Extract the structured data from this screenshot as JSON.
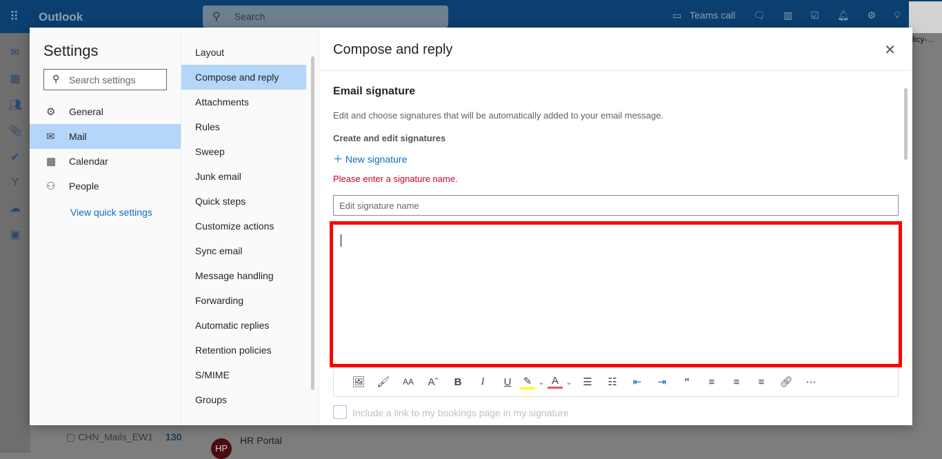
{
  "topbar": {
    "app": "Outlook",
    "search_placeholder": "Search",
    "teams_call": "Teams call"
  },
  "background": {
    "folder": "CHN_Mails_EW1",
    "folder_count": "130",
    "sender": "HR Portal",
    "sender_initials": "HP",
    "clipped_text": "licy-..."
  },
  "settings": {
    "title": "Settings",
    "search_placeholder": "Search settings",
    "categories": [
      {
        "label": "General",
        "icon": "gear-icon"
      },
      {
        "label": "Mail",
        "icon": "mail-icon",
        "selected": true
      },
      {
        "label": "Calendar",
        "icon": "calendar-icon"
      },
      {
        "label": "People",
        "icon": "people-icon"
      }
    ],
    "view_quick_settings": "View quick settings",
    "mail_sections": [
      "Layout",
      "Compose and reply",
      "Attachments",
      "Rules",
      "Sweep",
      "Junk email",
      "Quick steps",
      "Customize actions",
      "Sync email",
      "Message handling",
      "Forwarding",
      "Automatic replies",
      "Retention policies",
      "S/MIME",
      "Groups"
    ],
    "selected_section": "Compose and reply"
  },
  "compose": {
    "title": "Compose and reply",
    "signature_heading": "Email signature",
    "signature_desc": "Edit and choose signatures that will be automatically added to your email message.",
    "create_heading": "Create and edit signatures",
    "new_signature": "New signature",
    "error": "Please enter a signature name.",
    "name_placeholder": "Edit signature name",
    "signature_body": "",
    "toolbar": [
      "insert-picture",
      "format-painter",
      "font-size",
      "change-case",
      "bold",
      "italic",
      "underline",
      "highlight",
      "highlight-dropdown",
      "font-color",
      "font-color-dropdown",
      "bullets",
      "numbering",
      "decrease-indent",
      "increase-indent",
      "quote",
      "align-left",
      "align-center",
      "align-right",
      "link",
      "more"
    ],
    "highlight_color": "#ffff00",
    "font_color": "#e05a5a",
    "bookings_label": "Include a link to my bookings page in my signature",
    "bookings_checked": false,
    "highlight_border_color": "#ff0000"
  }
}
